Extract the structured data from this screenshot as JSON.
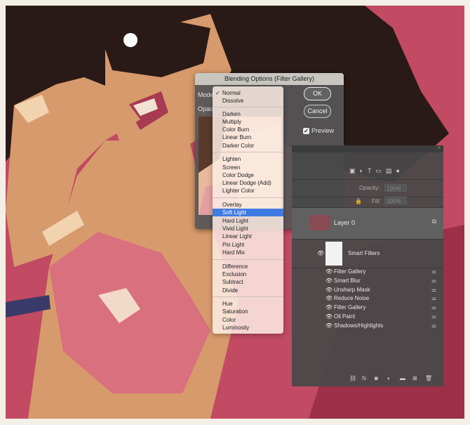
{
  "dialog": {
    "title": "Blending Options (Filter Gallery)",
    "mode_label": "Mode",
    "opacity_label": "Opac",
    "ok_label": "OK",
    "cancel_label": "Cancel",
    "preview_label": "Preview",
    "preview_checked": true
  },
  "mode_menu": {
    "selected": "Soft Light",
    "checked": "Normal",
    "groups": [
      [
        "Normal",
        "Dissolve"
      ],
      [
        "Darken",
        "Multiply",
        "Color Burn",
        "Linear Burn",
        "Darker Color"
      ],
      [
        "Lighten",
        "Screen",
        "Color Dodge",
        "Linear Dodge (Add)",
        "Lighter Color"
      ],
      [
        "Overlay",
        "Soft Light",
        "Hard Light",
        "Vivid Light",
        "Linear Light",
        "Pin Light",
        "Hard Mix"
      ],
      [
        "Difference",
        "Exclusion",
        "Subtract",
        "Divide"
      ],
      [
        "Hue",
        "Saturation",
        "Color",
        "Luminosity"
      ]
    ]
  },
  "layers_panel": {
    "opacity_label": "Opacity:",
    "opacity_value": "100%",
    "fill_label": "Fill:",
    "fill_value": "100%",
    "layer_name": "Layer 0",
    "smart_filters_label": "Smart Filters",
    "filters": [
      "Filter Gallery",
      "Smart Blur",
      "Unsharp Mask",
      "Reduce Noise",
      "Filter Gallery",
      "Oil Paint",
      "Shadows/Highlights"
    ]
  },
  "colors": {
    "accent": "#3f7be0",
    "background_pink": "#c24a62",
    "skin": "#d79a6c",
    "hair": "#2a1a17"
  }
}
